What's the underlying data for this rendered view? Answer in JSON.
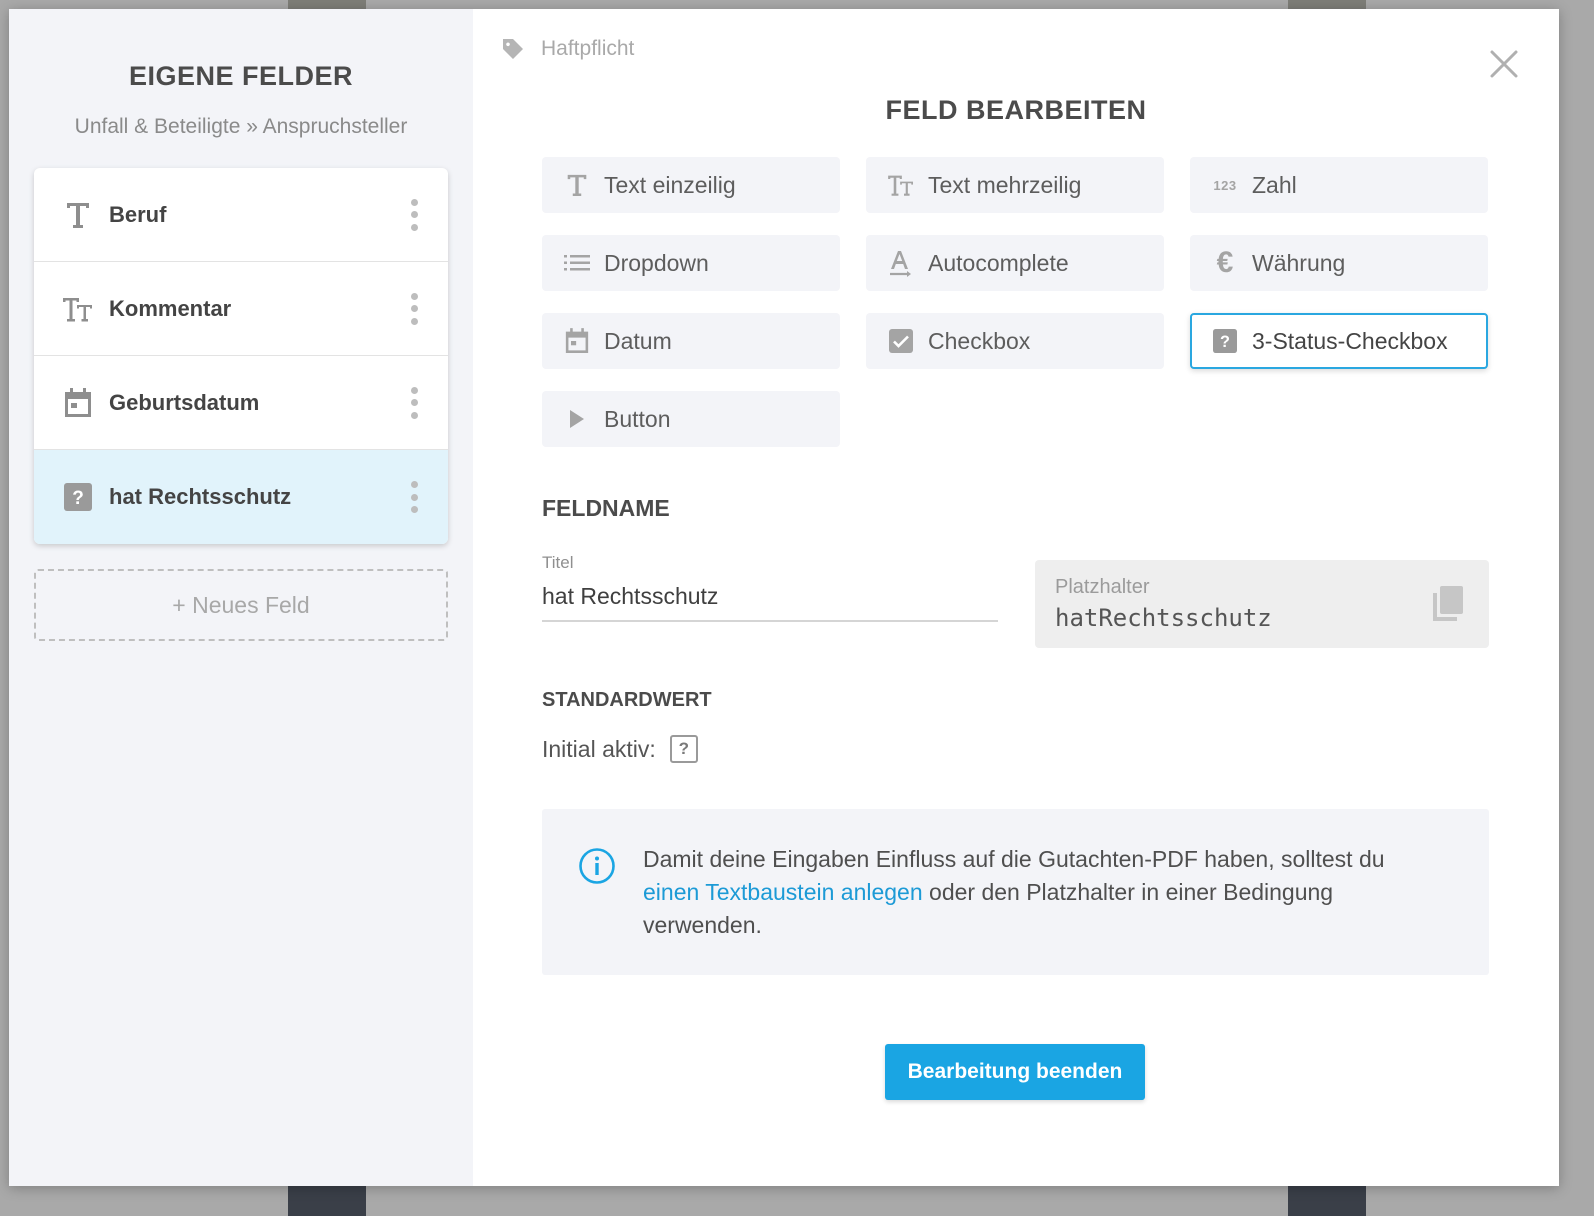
{
  "sidebar": {
    "title": "EIGENE FELDER",
    "breadcrumb": "Unfall & Beteiligte » Anspruchsteller",
    "fields": [
      {
        "label": "Beruf",
        "icon": "text-single-icon"
      },
      {
        "label": "Kommentar",
        "icon": "text-multi-icon"
      },
      {
        "label": "Geburtsdatum",
        "icon": "calendar-icon"
      },
      {
        "label": "hat Rechtsschutz",
        "icon": "question-box-icon",
        "active": true
      }
    ],
    "new_field_label": "+ Neues Feld"
  },
  "editor": {
    "category": "Haftpflicht",
    "title": "FELD BEARBEITEN",
    "types": [
      {
        "label": "Text einzeilig",
        "icon": "text-single-icon"
      },
      {
        "label": "Text mehrzeilig",
        "icon": "text-multi-icon"
      },
      {
        "label": "Zahl",
        "icon": "number-icon",
        "icon_text": "123"
      },
      {
        "label": "Dropdown",
        "icon": "list-icon"
      },
      {
        "label": "Autocomplete",
        "icon": "autocomplete-icon"
      },
      {
        "label": "Währung",
        "icon": "euro-icon",
        "icon_text": "€"
      },
      {
        "label": "Datum",
        "icon": "calendar-icon"
      },
      {
        "label": "Checkbox",
        "icon": "checkbox-icon"
      },
      {
        "label": "3-Status-Checkbox",
        "icon": "question-box-icon",
        "selected": true
      },
      {
        "label": "Button",
        "icon": "play-icon"
      }
    ],
    "fieldname_heading": "FELDNAME",
    "title_label": "Titel",
    "title_value": "hat Rechtsschutz",
    "placeholder_label": "Platzhalter",
    "placeholder_value": "hatRechtsschutz",
    "default_heading": "STANDARDWERT",
    "initial_label": "Initial aktiv:",
    "initial_state": "?",
    "info": {
      "text_before": "Damit deine Eingaben Einfluss auf die Gutachten-PDF haben, solltest du",
      "link_text": "einen Textbaustein anlegen",
      "text_after": "oder den Platzhalter in einer Bedingung verwenden."
    },
    "done_button": "Bearbeitung beenden"
  },
  "colors": {
    "accent": "#1aa5e3",
    "active_row": "#e1f3fb",
    "link": "#1c9ad6"
  }
}
